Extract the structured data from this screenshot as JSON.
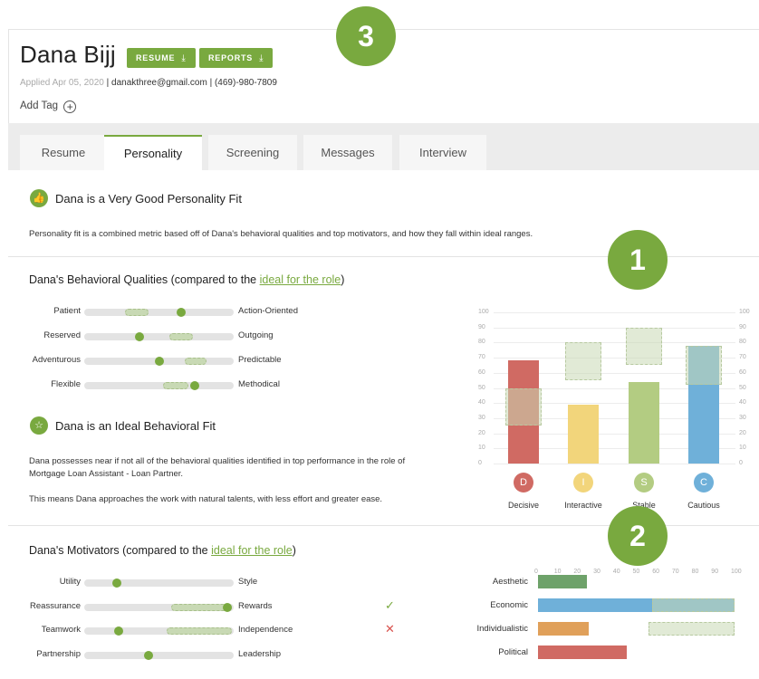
{
  "candidate": {
    "name": "Dana Bijj",
    "resume_label": "RESUME",
    "reports_label": "REPORTS",
    "download_glyph": "⤓",
    "applied": "Applied Apr 05, 2020",
    "email": "danakthree@gmail.com",
    "phone": "(469)-980-7809",
    "add_tag_label": "Add Tag",
    "add_glyph": "+"
  },
  "badges": {
    "one": "1",
    "two": "2",
    "three": "3"
  },
  "tabs": [
    {
      "label": "Resume"
    },
    {
      "label": "Personality"
    },
    {
      "label": "Screening"
    },
    {
      "label": "Messages"
    },
    {
      "label": "Interview"
    }
  ],
  "personality_fit": {
    "title": "Dana is a Very Good Personality Fit",
    "description": "Personality fit is a combined metric based off of Dana's behavioral qualities and top motivators, and how they fall within ideal ranges.",
    "icon": "thumbs-up-icon"
  },
  "behavioral": {
    "title_prefix": "Dana's Behavioral Qualities (compared to the ",
    "link": "ideal for the role",
    "title_suffix": ")",
    "scales": [
      {
        "left": "Patient",
        "right": "Action-Oriented",
        "value": 0.65,
        "ideal": [
          0.27,
          0.43
        ]
      },
      {
        "left": "Reserved",
        "right": "Outgoing",
        "value": 0.37,
        "ideal": [
          0.57,
          0.73
        ]
      },
      {
        "left": "Adventurous",
        "right": "Predictable",
        "value": 0.5,
        "ideal": [
          0.67,
          0.82
        ]
      },
      {
        "left": "Flexible",
        "right": "Methodical",
        "value": 0.74,
        "ideal": [
          0.53,
          0.7
        ]
      }
    ]
  },
  "behavioral_fit": {
    "title": "Dana is an Ideal Behavioral Fit",
    "icon": "star-icon",
    "p1": "Dana possesses near if not all of the behavioral qualities identified in top performance in the role of",
    "p1b": "Mortgage Loan Assistant - Loan Partner.",
    "p2": "This means Dana approaches the work with natural talents, with less effort and greater ease."
  },
  "chart_data": [
    {
      "type": "bar",
      "categories": [
        "Decisive",
        "Interactive",
        "Stable",
        "Cautious"
      ],
      "letters": [
        "D",
        "I",
        "S",
        "C"
      ],
      "colors": [
        "#d06a63",
        "#f2d57b",
        "#b3cc82",
        "#6fb0d9"
      ],
      "values": [
        68,
        39,
        54,
        78
      ],
      "ideal_ranges": [
        [
          25,
          50
        ],
        [
          55,
          80
        ],
        [
          65,
          90
        ],
        [
          52,
          78
        ]
      ],
      "yticks": [
        0,
        10,
        20,
        30,
        40,
        50,
        60,
        70,
        80,
        90,
        100
      ],
      "ylim": [
        0,
        100
      ],
      "grid": true
    },
    {
      "type": "bar",
      "orientation": "horizontal",
      "categories": [
        "Aesthetic",
        "Economic",
        "Individualistic",
        "Political"
      ],
      "colors": [
        "#6ea26a",
        "#6fb0d9",
        "#e0a05a",
        "#d06a63"
      ],
      "values": [
        25,
        100,
        26,
        45
      ],
      "ideal_ranges": [
        null,
        [
          58,
          100
        ],
        [
          56,
          100
        ],
        null
      ],
      "xticks": [
        0,
        10,
        20,
        30,
        40,
        50,
        60,
        70,
        80,
        90,
        100
      ],
      "xlim": [
        0,
        100
      ]
    }
  ],
  "motivators": {
    "title_prefix": "Dana's Motivators (compared to the ",
    "link": "ideal for the role",
    "title_suffix": ")",
    "scales": [
      {
        "left": "Utility",
        "right": "Style",
        "value": 0.22,
        "ideal": null,
        "mark": ""
      },
      {
        "left": "Reassurance",
        "right": "Rewards",
        "value": 0.96,
        "ideal": [
          0.58,
          0.99
        ],
        "mark": "✓"
      },
      {
        "left": "Teamwork",
        "right": "Independence",
        "value": 0.23,
        "ideal": [
          0.55,
          0.99
        ],
        "mark": "✕"
      },
      {
        "left": "Partnership",
        "right": "Leadership",
        "value": 0.43,
        "ideal": null,
        "mark": ""
      }
    ]
  }
}
